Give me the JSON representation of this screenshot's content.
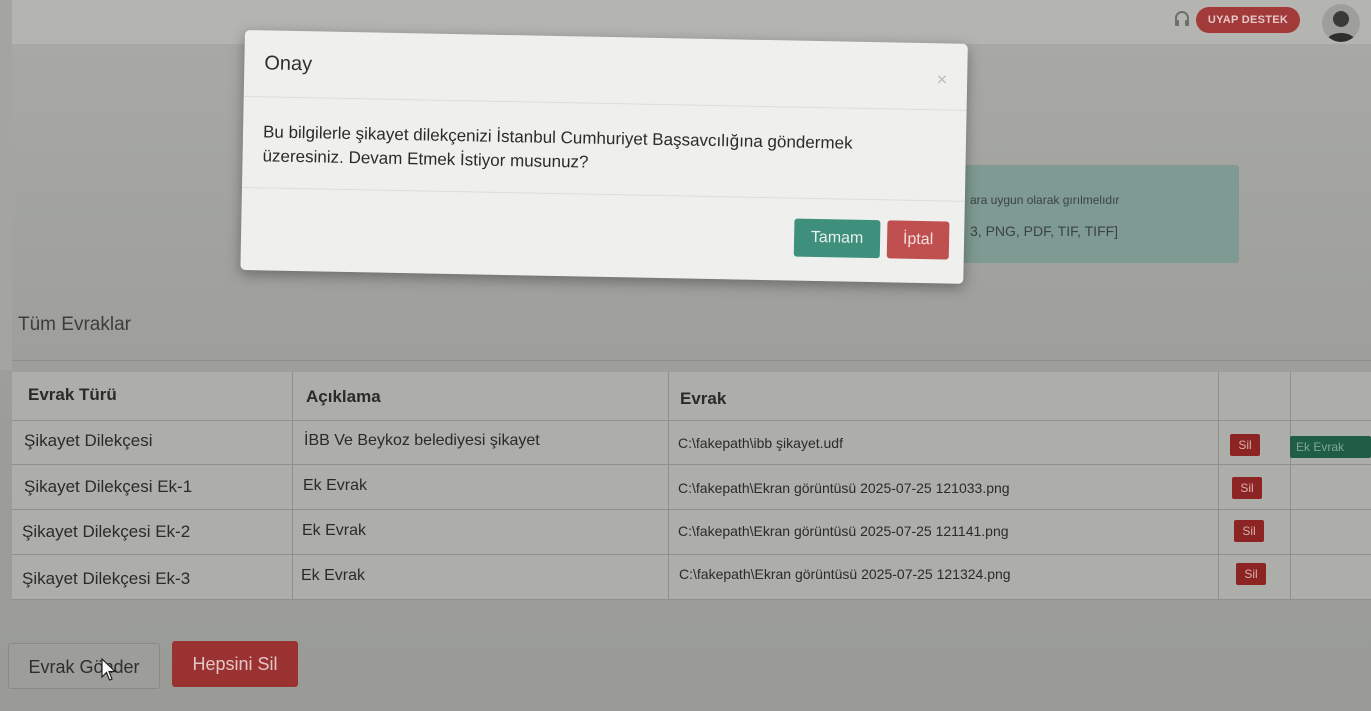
{
  "header": {
    "support_label": "UYAP DESTEK",
    "icons": [
      "headset-icon",
      "avatar"
    ]
  },
  "info": {
    "line1": "ara uygun olarak gırılmelıdır",
    "line2": "3, PNG, PDF, TIF, TIFF]"
  },
  "section": {
    "title": "Tüm Evraklar"
  },
  "table": {
    "columns": [
      "Evrak Türü",
      "Açıklama",
      "Evrak"
    ],
    "rows": [
      {
        "type": "Şikayet Dilekçesi",
        "description": "İBB Ve Beykoz belediyesi şikayet",
        "file": "C:\\fakepath\\ibb şikayet.udf",
        "delete_label": "Sil",
        "extra_label": "Ek Evrak"
      },
      {
        "type": "Şikayet Dilekçesi Ek-1",
        "description": "Ek Evrak",
        "file": "C:\\fakepath\\Ekran görüntüsü 2025-07-25 121033.png",
        "delete_label": "Sil"
      },
      {
        "type": "Şikayet Dilekçesi Ek-2",
        "description": "Ek Evrak",
        "file": "C:\\fakepath\\Ekran görüntüsü 2025-07-25 121141.png",
        "delete_label": "Sil"
      },
      {
        "type": "Şikayet Dilekçesi Ek-3",
        "description": "Ek Evrak",
        "file": "C:\\fakepath\\Ekran görüntüsü 2025-07-25 121324.png",
        "delete_label": "Sil"
      }
    ]
  },
  "actions": {
    "send_label": "Evrak Gönder",
    "delete_all_label": "Hepsini Sil"
  },
  "modal": {
    "title": "Onay",
    "close_symbol": "×",
    "message": "Bu bilgilerle şikayet dilekçenizi İstanbul Cumhuriyet Başsavcılığına göndermek üzeresiniz. Devam Etmek İstiyor musunuz?",
    "ok_label": "Tamam",
    "cancel_label": "İptal"
  },
  "colors": {
    "ok": "#3f8f7d",
    "cancel": "#c05050",
    "delete": "#8c2424",
    "extra": "#1f5e45"
  }
}
